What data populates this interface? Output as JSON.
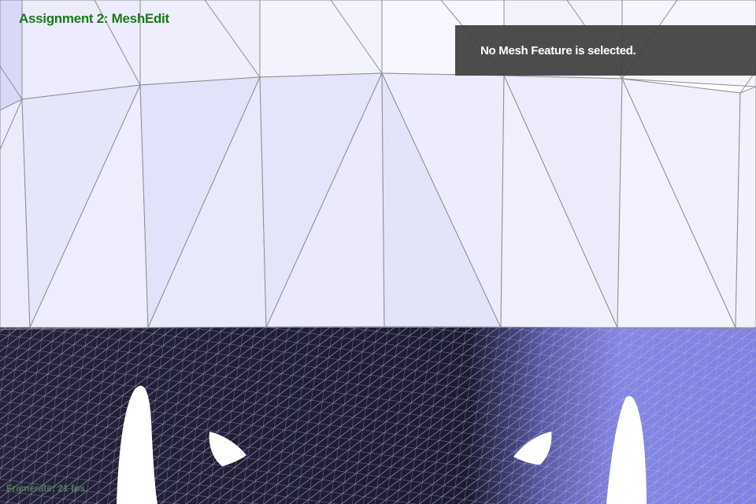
{
  "app": {
    "title": "Assignment 2: MeshEdit"
  },
  "info_panel": {
    "message": "No Mesh Feature is selected."
  },
  "status": {
    "fps": "Framerate: 21 fps"
  },
  "colors": {
    "title": "#1a7a1a",
    "panel_text": "#ffffff",
    "panel_bg": "#404040",
    "wire": "#8e8e8e",
    "light_face": "#e8e8fb",
    "dark_mesh": "#1c1b33",
    "lit_mesh": "#7d7fe8",
    "hole": "#ffffff",
    "fps": "#5a9a5a"
  }
}
